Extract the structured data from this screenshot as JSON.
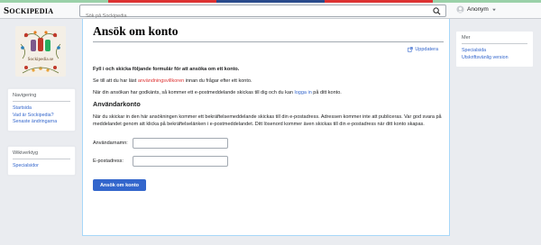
{
  "colors": {
    "accent": "#3366cc",
    "stripe": [
      "#9ad1a9",
      "#d33",
      "#2a4b8d",
      "#d33",
      "#9ad1a9"
    ]
  },
  "header": {
    "logo": "Sockipedia",
    "search_placeholder": "Sök på Sockipedia",
    "user": "Anonym"
  },
  "sidebar": {
    "site_logo_text": "Sockipedia.se",
    "navigation": {
      "title": "Navigering",
      "items": [
        "Startsida",
        "Vad är Sockipedia?",
        "Senaste ändringarna"
      ]
    },
    "tools": {
      "title": "Wikiverktyg",
      "items": [
        "Specialsidor"
      ]
    }
  },
  "right_panel": {
    "title": "Mer",
    "items": [
      "Specialsida",
      "Utskriftsvänlig version"
    ]
  },
  "page": {
    "title": "Ansök om konto",
    "update_link": "Uppdatera",
    "intro_bold": "Fyll i och skicka följande formulär för att ansöka om ett konto.",
    "terms_pre": "Se till att du har läst ",
    "terms_link": "användningsvillkoren",
    "terms_post": " innan du frågar efter ett konto.",
    "approval_pre": "När din ansökan har godkänts, så kommer ett e-postmeddelande skickas till dig och du kan ",
    "approval_link": "logga in",
    "approval_post": " på ditt konto.",
    "section_heading": "Användarkonto",
    "section_text": "När du skickar in den här ansökningen kommer ett bekräftelsemeddelande skickas till din e-postadress. Adressen kommer inte att publiceras. Var god svara på meddelandet genom att klicka på bekräftelselänken i e-postmeddelandet. Ditt lösenord kommer även skickas till din e-postadress när ditt konto skapas.",
    "username_label": "Användarnamn:",
    "username_value": "",
    "email_label": "E-postadress:",
    "email_value": "",
    "submit_label": "Ansök om konto"
  }
}
